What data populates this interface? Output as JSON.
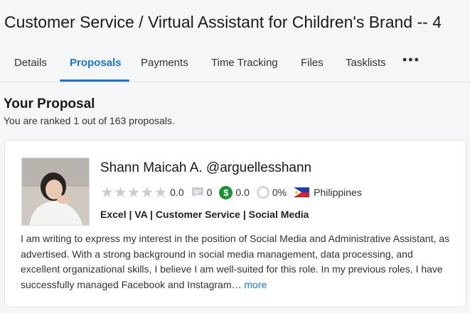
{
  "job": {
    "title": "Customer Service / Virtual Assistant for Children's Brand -- 4"
  },
  "tabs": [
    {
      "label": "Details"
    },
    {
      "label": "Proposals"
    },
    {
      "label": "Payments"
    },
    {
      "label": "Time Tracking"
    },
    {
      "label": "Files"
    },
    {
      "label": "Tasklists"
    }
  ],
  "more_menu": {
    "label": "•••"
  },
  "section": {
    "title": "Your Proposal",
    "rank_text": "You are ranked 1 out of 163 proposals."
  },
  "proposal": {
    "name": "Shann Maicah A. @arguellesshann",
    "rating": "0.0",
    "rating_stars": 0,
    "reviews": "0",
    "earnings": "0.0",
    "job_success": "0%",
    "country": "Philippines",
    "skills": "Excel | VA | Customer Service | Social Media",
    "cover_letter": "I am writing to express my interest in the position of Social Media and Administrative Assistant, as advertised. With a strong background in social media management, data processing, and excellent organizational skills, I believe I am well-suited for this role. In my previous roles, I have successfully managed Facebook and Instagram…",
    "more_label": "more"
  },
  "colors": {
    "accent": "#1a73d9",
    "money_green": "#1f8f3a",
    "star_empty": "#c9ced6"
  },
  "icons": [
    "star-icon",
    "chat-icon",
    "dollar-icon",
    "job-success-ring-icon",
    "philippines-flag-icon",
    "more-dots-icon"
  ]
}
